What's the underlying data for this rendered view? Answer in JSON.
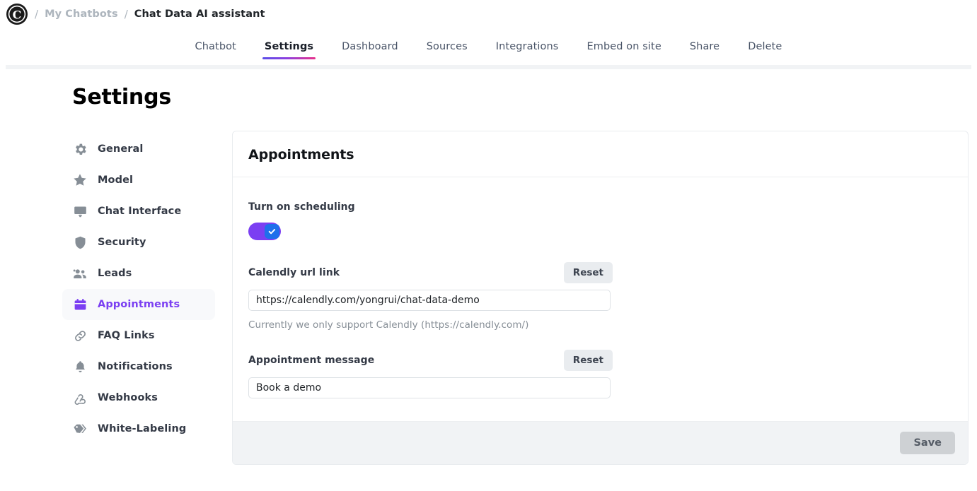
{
  "header": {
    "logo_icon": "copyright-c-logo",
    "breadcrumb": {
      "separator": "/",
      "parent": "My Chatbots",
      "current": "Chat Data AI assistant"
    }
  },
  "tabs": [
    {
      "label": "Chatbot",
      "active": false
    },
    {
      "label": "Settings",
      "active": true
    },
    {
      "label": "Dashboard",
      "active": false
    },
    {
      "label": "Sources",
      "active": false
    },
    {
      "label": "Integrations",
      "active": false
    },
    {
      "label": "Embed on site",
      "active": false
    },
    {
      "label": "Share",
      "active": false
    },
    {
      "label": "Delete",
      "active": false
    }
  ],
  "page": {
    "title": "Settings"
  },
  "sidebar": {
    "items": [
      {
        "label": "General",
        "icon": "gear-icon",
        "active": false
      },
      {
        "label": "Model",
        "icon": "star-icon",
        "active": false
      },
      {
        "label": "Chat Interface",
        "icon": "monitor-icon",
        "active": false
      },
      {
        "label": "Security",
        "icon": "shield-icon",
        "active": false
      },
      {
        "label": "Leads",
        "icon": "people-icon",
        "active": false
      },
      {
        "label": "Appointments",
        "icon": "calendar-icon",
        "active": true
      },
      {
        "label": "FAQ Links",
        "icon": "link-icon",
        "active": false
      },
      {
        "label": "Notifications",
        "icon": "bell-icon",
        "active": false
      },
      {
        "label": "Webhooks",
        "icon": "webhook-icon",
        "active": false
      },
      {
        "label": "White-Labeling",
        "icon": "tag-icon",
        "active": false
      }
    ]
  },
  "main": {
    "card_title": "Appointments",
    "scheduling": {
      "label": "Turn on scheduling",
      "enabled": true,
      "toggle_icon": "check-icon"
    },
    "calendly": {
      "label": "Calendly url link",
      "reset_label": "Reset",
      "value": "https://calendly.com/yongrui/chat-data-demo",
      "placeholder": "https://calendly.com/",
      "help": "Currently we only support Calendly (https://calendly.com/)"
    },
    "appointment_message": {
      "label": "Appointment message",
      "reset_label": "Reset",
      "value": "Book a demo",
      "placeholder": "Book a demo"
    },
    "footer": {
      "save_label": "Save",
      "save_disabled": true
    }
  },
  "colors": {
    "accent_purple": "#7b3ff2",
    "toggle_knob_blue": "#1f6feb",
    "tab_gradient_start": "#5b4ee8",
    "tab_gradient_end": "#e8308a",
    "footer_bg": "#f1f3f5",
    "muted_text": "#868e96"
  }
}
